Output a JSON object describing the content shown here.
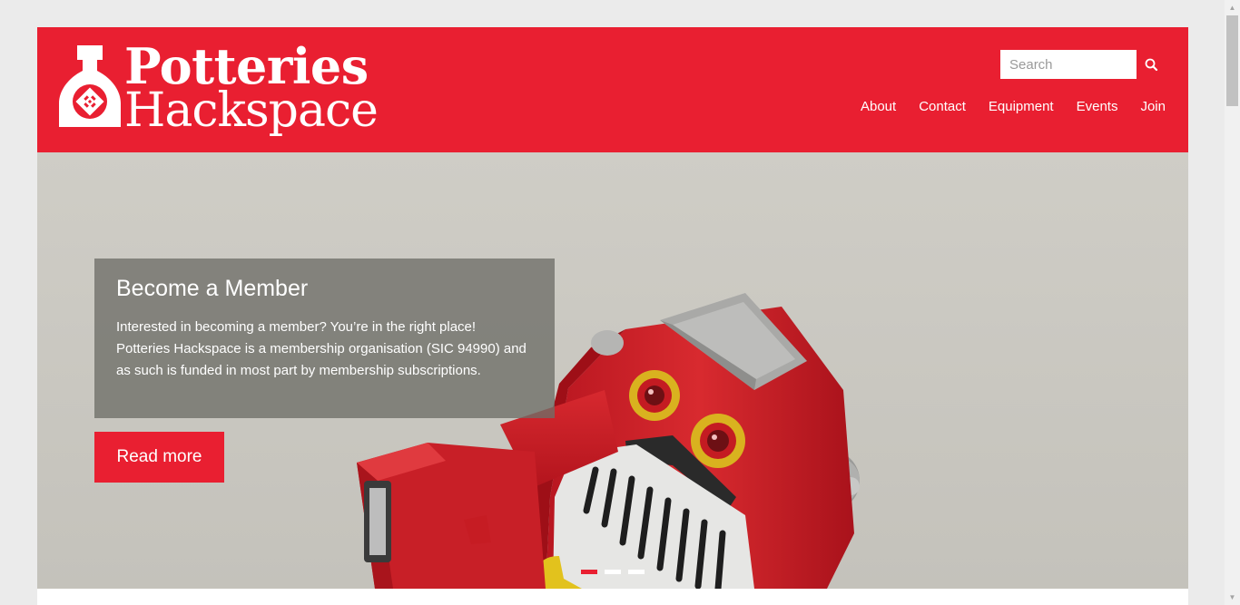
{
  "header": {
    "logo": {
      "line1": "Potteries",
      "line2": "Hackspace"
    },
    "search": {
      "placeholder": "Search",
      "value": "",
      "icon": "search-icon"
    },
    "nav": [
      {
        "label": "About"
      },
      {
        "label": "Contact"
      },
      {
        "label": "Equipment"
      },
      {
        "label": "Events"
      },
      {
        "label": "Join"
      }
    ]
  },
  "hero": {
    "caption": {
      "title": "Become a Member",
      "text": "Interested in becoming a member? You’re in the right place! Potteries Hackspace is a membership organisation (SIC 94990) and as such is funded in most part by membership subscriptions."
    },
    "button_label": "Read more",
    "slides_total": 3,
    "active_slide": 1
  },
  "colors": {
    "brand": "#e91f31",
    "caption_bg": "#6e6e68",
    "page_bg": "#ebebeb"
  }
}
